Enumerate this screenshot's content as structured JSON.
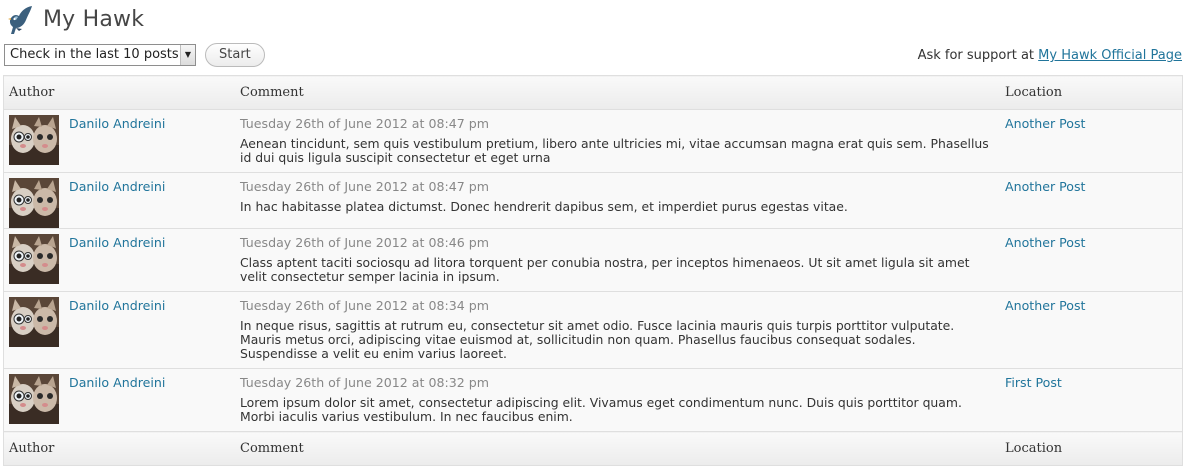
{
  "header": {
    "title": "My Hawk",
    "logo_icon": "hawk-bird-icon"
  },
  "controls": {
    "filter_select": {
      "selected": "Check in the last 10 posts"
    },
    "start_label": "Start"
  },
  "support": {
    "prefix": "Ask for support at",
    "link_text": "My Hawk Official Page"
  },
  "table": {
    "columns": [
      "Author",
      "Comment",
      "Location"
    ],
    "rows": [
      {
        "author": "Danilo Andreini",
        "date": "Tuesday 26th of June 2012 at 08:47 pm",
        "comment": "Aenean tincidunt, sem quis vestibulum pretium, libero ante ultricies mi, vitae accumsan magna erat quis sem. Phasellus id dui quis ligula suscipit consectetur et eget urna",
        "location": "Another Post"
      },
      {
        "author": "Danilo Andreini",
        "date": "Tuesday 26th of June 2012 at 08:47 pm",
        "comment": "In hac habitasse platea dictumst. Donec hendrerit dapibus sem, et imperdiet purus egestas vitae.",
        "location": "Another Post"
      },
      {
        "author": "Danilo Andreini",
        "date": "Tuesday 26th of June 2012 at 08:46 pm",
        "comment": "Class aptent taciti sociosqu ad litora torquent per conubia nostra, per inceptos himenaeos. Ut sit amet ligula sit amet velit consectetur semper lacinia in ipsum.",
        "location": "Another Post"
      },
      {
        "author": "Danilo Andreini",
        "date": "Tuesday 26th of June 2012 at 08:34 pm",
        "comment": "In neque risus, sagittis at rutrum eu, consectetur sit amet odio. Fusce lacinia mauris quis turpis porttitor vulputate. Mauris metus orci, adipiscing vitae euismod at, sollicitudin non quam. Phasellus faucibus consequat sodales. Suspendisse a velit eu enim varius laoreet.",
        "location": "Another Post"
      },
      {
        "author": "Danilo Andreini",
        "date": "Tuesday 26th of June 2012 at 08:32 pm",
        "comment": "Lorem ipsum dolor sit amet, consectetur adipiscing elit. Vivamus eget condimentum nunc. Duis quis porttitor quam. Morbi iaculis varius vestibulum. In nec faucibus enim.",
        "location": "First Post"
      }
    ]
  },
  "colors": {
    "link": "#21759b",
    "date": "#888888",
    "row_bg": "#f9f9f9"
  }
}
